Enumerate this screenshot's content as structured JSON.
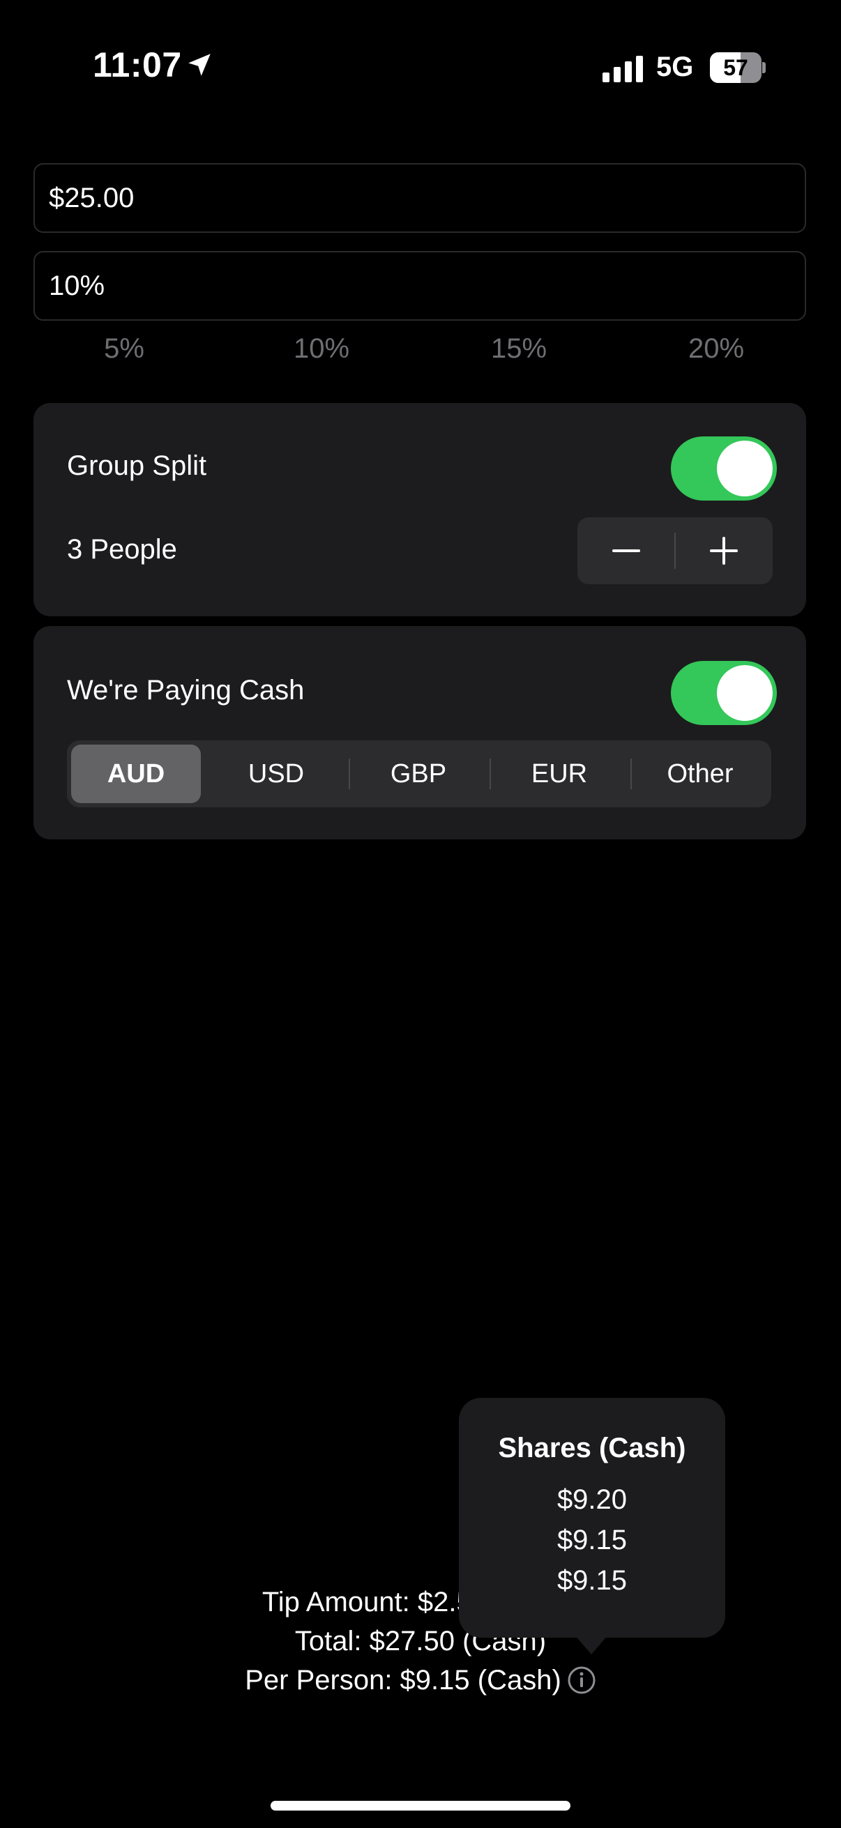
{
  "status_bar": {
    "time": "11:07",
    "network": "5G",
    "battery_level": "57"
  },
  "bill": {
    "amount_value": "$25.00"
  },
  "tip": {
    "percent_value": "10%",
    "presets": [
      "5%",
      "10%",
      "15%",
      "20%"
    ]
  },
  "group_split": {
    "label": "Group Split",
    "enabled": true,
    "people_label": "3 People",
    "decrement_symbol": "−",
    "increment_symbol": "+"
  },
  "cash": {
    "label": "We're Paying Cash",
    "enabled": true,
    "currencies": [
      "AUD",
      "USD",
      "GBP",
      "EUR",
      "Other"
    ],
    "selected_currency": "AUD"
  },
  "results": {
    "tip_amount": "Tip Amount: $2.50 (Cash)",
    "total": "Total: $27.50 (Cash)",
    "per_person": "Per Person: $9.15 (Cash)"
  },
  "popover": {
    "title": "Shares (Cash)",
    "shares": [
      "$9.20",
      "$9.15",
      "$9.15"
    ]
  },
  "colors": {
    "toggle_on": "#34c759",
    "card_bg": "#1c1c1e",
    "segment_selected": "#636366"
  }
}
